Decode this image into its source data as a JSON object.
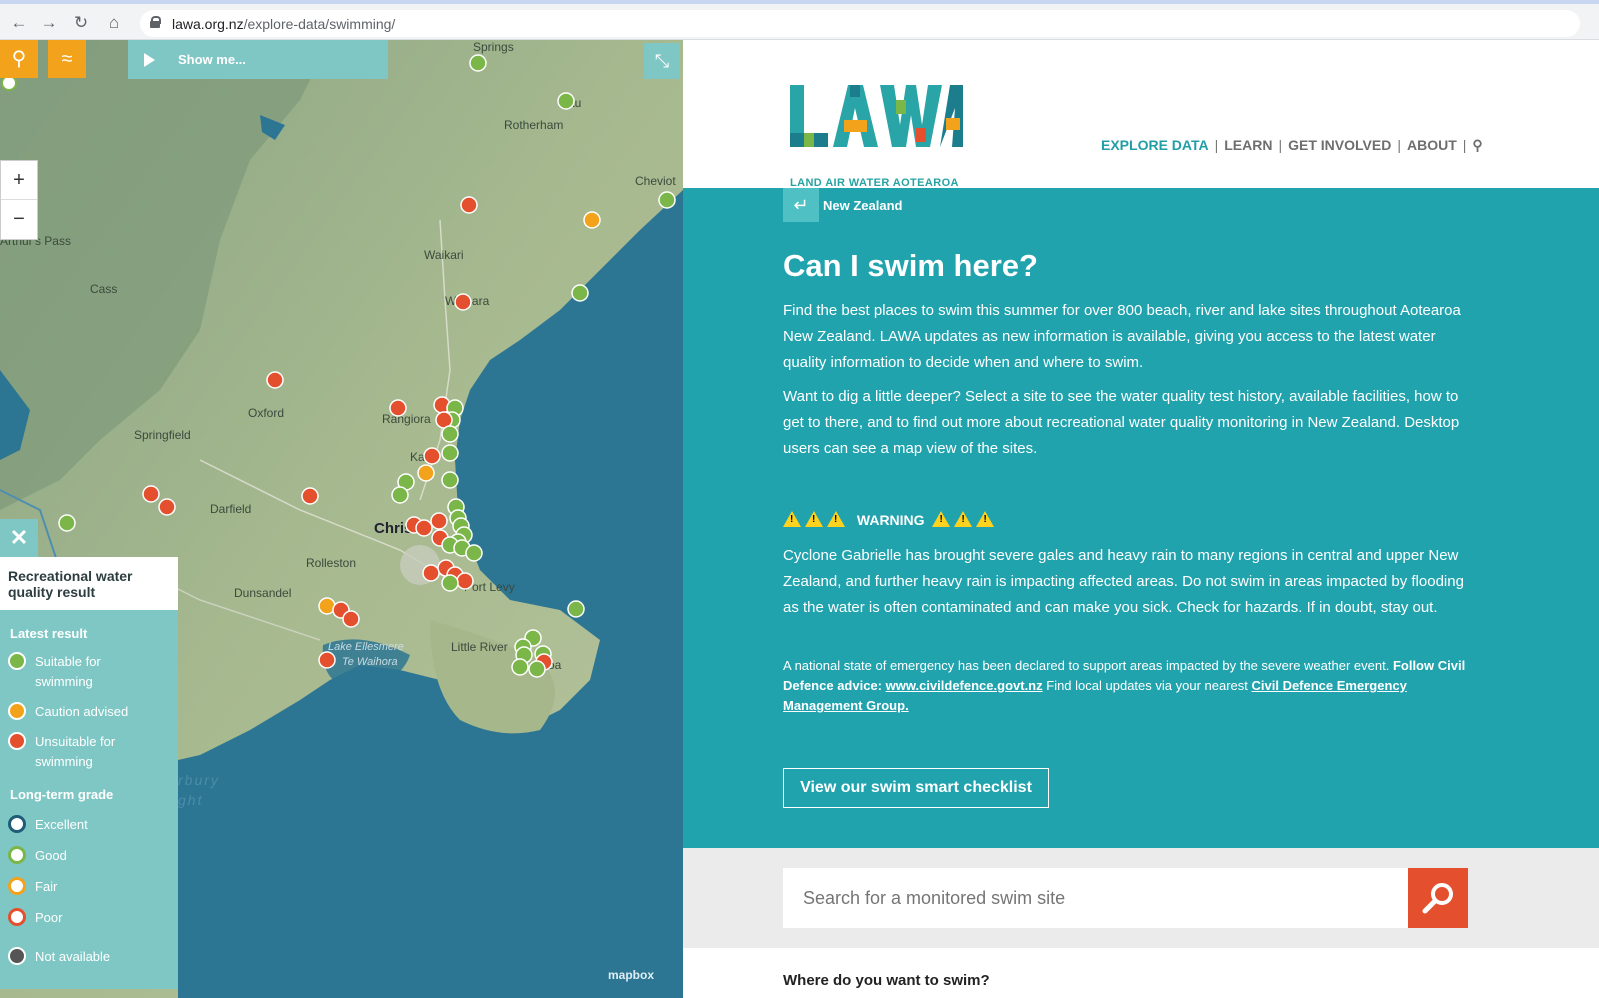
{
  "browser": {
    "url_host": "lawa.org.nz",
    "url_path": "/explore-data/swimming/"
  },
  "map": {
    "show_me_label": "Show me...",
    "zoom_in": "+",
    "zoom_out": "−",
    "labels": {
      "springs": "Springs",
      "rotherham": "Rotherham",
      "cheviot": "Cheviot",
      "waikari": "Waikari",
      "cass": "Cass",
      "arthurs_pass": "Arthur's Pass",
      "waipara": "Waipara",
      "oxford": "Oxford",
      "rangiora": "Rangiora",
      "springfield": "Springfield",
      "kaiapoi": "Ka",
      "darfield": "Darfield",
      "christchurch": "Chris",
      "rolleston": "Rolleston",
      "dunsandel": "Dunsandel",
      "lyttelton": "Port Levy",
      "little_river": "Little River",
      "akaroa": "oa",
      "lake": "Lake Ellesmere",
      "lake2": "Te Waihora",
      "bight1": "rbury",
      "bight2": "ght",
      "culverden": "au"
    },
    "attribution": "mapbox"
  },
  "legend": {
    "title": "Recreational water quality result",
    "latest_header": "Latest result",
    "suitable": "Suitable for swimming",
    "caution": "Caution advised",
    "unsuitable": "Unsuitable for swimming",
    "grade_header": "Long-term grade",
    "excellent": "Excellent",
    "good": "Good",
    "fair": "Fair",
    "poor": "Poor",
    "na": "Not available",
    "colors": {
      "green": "#7ab648",
      "orange": "#f3a21c",
      "red": "#e4502e",
      "navy": "#1d5e76",
      "grey": "#555555"
    }
  },
  "header": {
    "logo_sub": "LAND AIR WATER AOTEAROA",
    "nav": [
      "EXPLORE DATA",
      "LEARN",
      "GET INVOLVED",
      "ABOUT"
    ]
  },
  "main": {
    "crumb": "New Zealand",
    "title": "Can I swim here?",
    "p1": "Find the best places to swim this summer for over 800 beach, river and lake sites throughout Aotearoa New Zealand.  LAWA updates as new information is available, giving you access to the latest water quality information to decide when and where to swim.",
    "p2": "Want to dig a little deeper?  Select a site to see the water quality test history, available facilities, how to get to there, and to find out more about recreational water quality monitoring in New Zealand.  Desktop users can see a map view of the sites.",
    "warning": "WARNING",
    "p3": "Cyclone Gabrielle has brought severe gales and heavy rain to many regions in central and upper New Zealand, and further heavy rain is impacting affected areas.  Do not swim in areas impacted by flooding as the water is often contaminated and can make you sick.  Check for hazards.  If in doubt, stay out.",
    "small_a": "A national state of emergency has been declared to support areas impacted by the severe weather event.",
    "small_b": "Follow Civil Defence advice:",
    "small_link1": "www.civildefence.govt.nz",
    "small_c": "Find local updates via your nearest",
    "small_link2": "Civil Defence Emergency Management Group.",
    "checklist": "View our swim smart checklist",
    "search_placeholder": "Search for a monitored swim site",
    "where": "Where do you want to swim?"
  }
}
